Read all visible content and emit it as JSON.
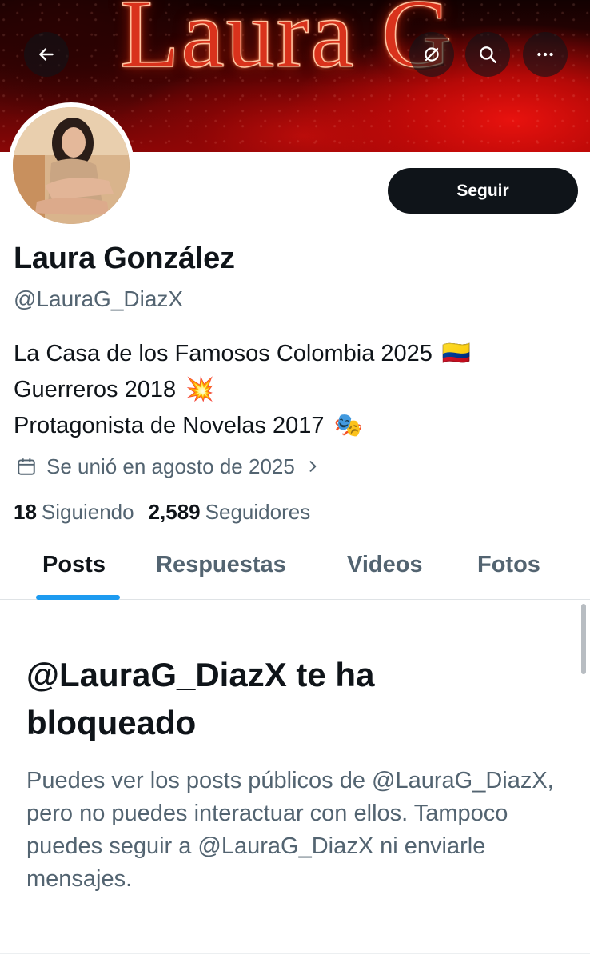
{
  "banner": {
    "title_art": "Laura G"
  },
  "nav": {
    "back_icon": "arrow-left-icon",
    "noloc_icon": "location-off-icon",
    "search_icon": "search-icon",
    "more_icon": "more-horizontal-icon"
  },
  "profile": {
    "name": "Laura González",
    "handle": "@LauraG_DiazX",
    "follow_label": "Seguir",
    "bio": [
      {
        "text": "La Casa de los Famosos Colombia 2025",
        "emoji": "🇨🇴"
      },
      {
        "text": "Guerreros 2018",
        "emoji": "💥"
      },
      {
        "text": "Protagonista de Novelas 2017",
        "emoji": "🎭"
      }
    ],
    "joined": "Se unió en agosto de 2025",
    "following_count": "18",
    "following_label": "Siguiendo",
    "followers_count": "2,589",
    "followers_label": "Seguidores"
  },
  "tabs": [
    {
      "label": "Posts",
      "active": true
    },
    {
      "label": "Respuestas",
      "active": false
    },
    {
      "label": "Videos",
      "active": false
    },
    {
      "label": "Fotos",
      "active": false
    }
  ],
  "blocked": {
    "title": "@LauraG_DiazX te ha bloqueado",
    "message": "Puedes ver los posts públicos de @LauraG_DiazX, pero no puedes interactuar con ellos. Tampoco puedes seguir a @LauraG_DiazX ni enviarle mensajes."
  },
  "colors": {
    "primary_text": "#0f1419",
    "secondary_text": "#536471",
    "accent": "#1d9bf0",
    "follow_bg": "#0f1419"
  }
}
